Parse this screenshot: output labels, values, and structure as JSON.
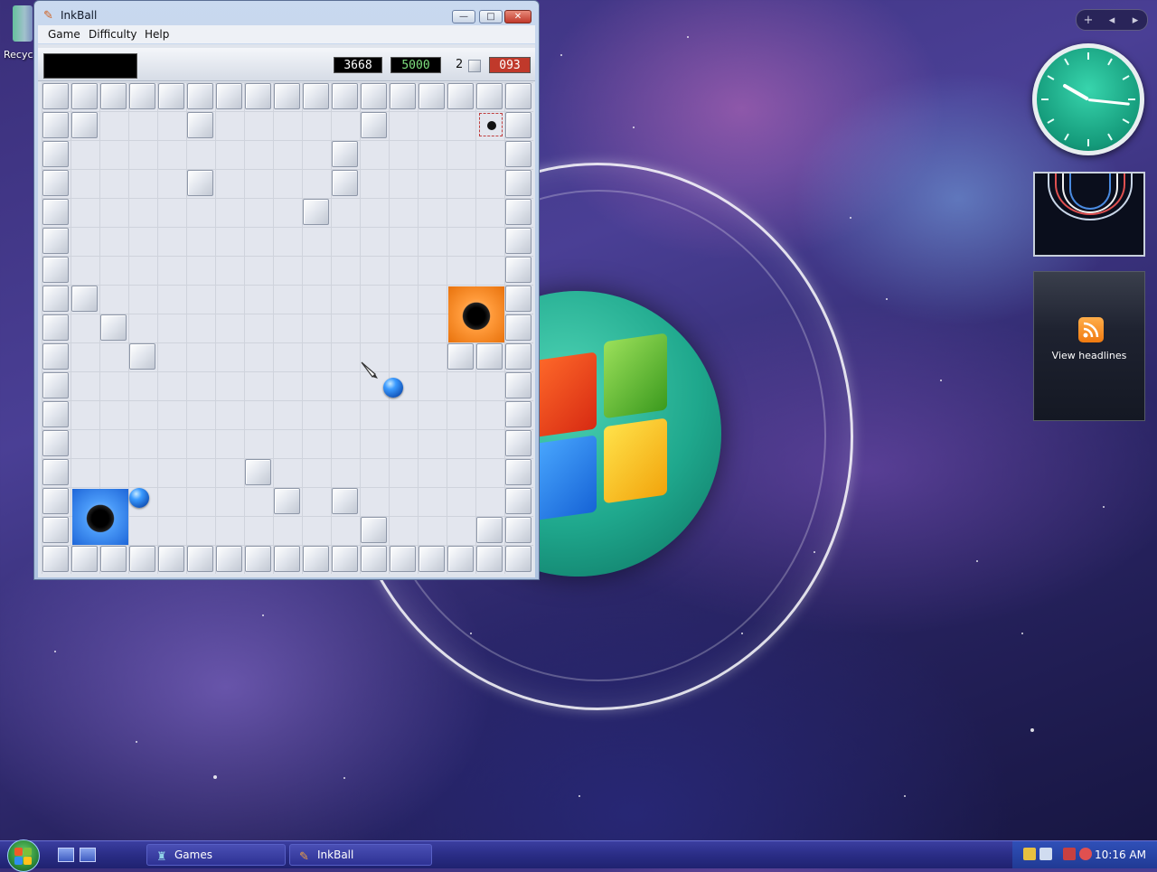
{
  "desktop": {
    "recycle_bin_label": "Recyc"
  },
  "sidebar": {
    "controls": [
      "+",
      "◂",
      "▸"
    ],
    "feed_label": "View headlines"
  },
  "window": {
    "title": "InkBall",
    "controls": {
      "minimize": "—",
      "maximize": "□",
      "close": "✕"
    },
    "menu": [
      "Game",
      "Difficulty",
      "Help"
    ],
    "score": "3668",
    "high_score": "5000",
    "balls_remaining": "2",
    "time": "093"
  },
  "taskbar": {
    "tasks": [
      {
        "label": "Games",
        "icon": "games-icon"
      },
      {
        "label": "InkBall",
        "icon": "inkball-icon"
      }
    ],
    "clock": "10:16 AM"
  },
  "colors": {
    "orange_hole": "#ff9a3a",
    "blue_hole": "#4a9af8",
    "ball_blue": "#3a9aff",
    "time_red": "#c0392b",
    "high_score_green": "#7fe07f"
  }
}
